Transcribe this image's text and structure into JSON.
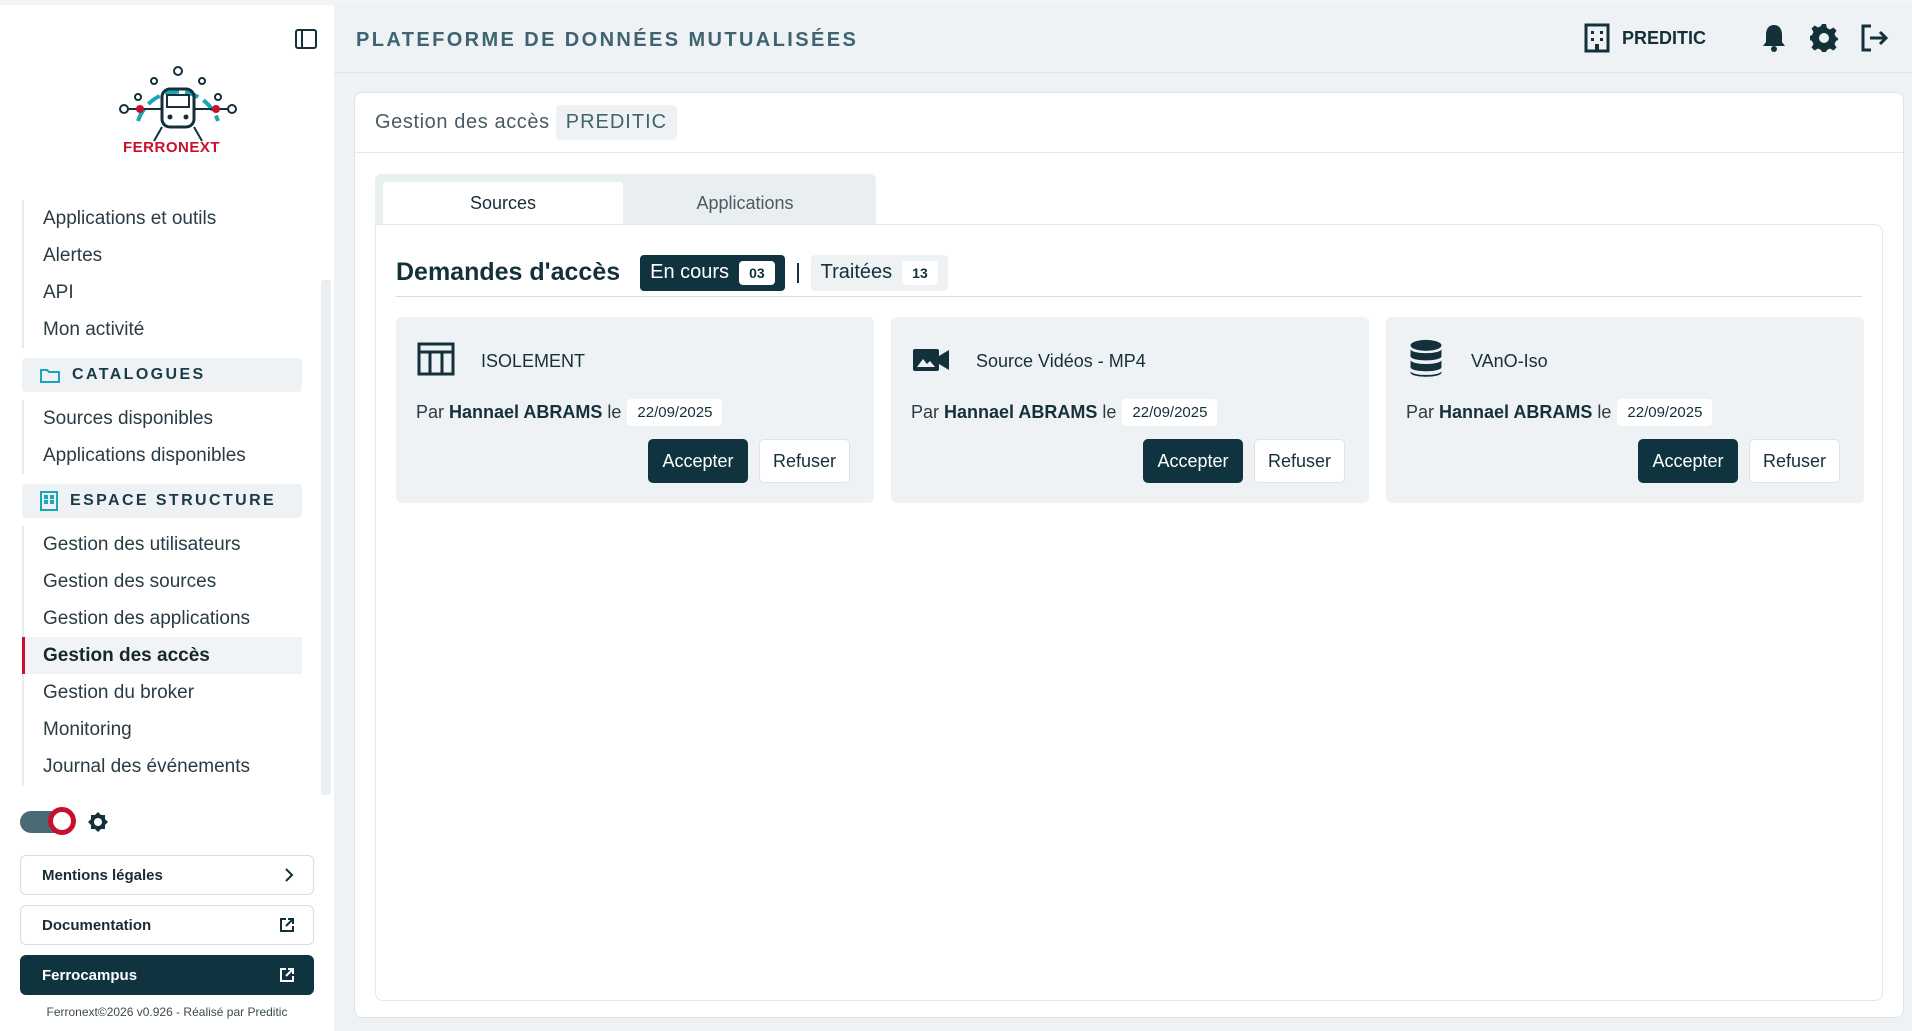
{
  "header": {
    "title": "PLATEFORME DE DONNÉES MUTUALISÉES",
    "org_name": "PREDITIC"
  },
  "sidebar": {
    "logo_text": "FERRONEXT",
    "items_top": [
      "Applications et outils",
      "Alertes",
      "API",
      "Mon activité"
    ],
    "section_catalogues": "CATALOGUES",
    "items_catalogues": [
      "Sources disponibles",
      "Applications disponibles"
    ],
    "section_structure": "ESPACE STRUCTURE",
    "items_structure": [
      "Gestion des utilisateurs",
      "Gestion des sources",
      "Gestion des applications",
      "Gestion des accès",
      "Gestion du broker",
      "Monitoring",
      "Journal des événements"
    ],
    "active_item": "Gestion des accès",
    "buttons": {
      "mentions": "Mentions légales",
      "documentation": "Documentation",
      "ferrocampus": "Ferrocampus"
    },
    "footer": "Ferronext©2026 v0.926 - Réalisé par Preditic"
  },
  "page": {
    "title": "Gestion des accès",
    "org_badge": "PREDITIC",
    "tabs": [
      "Sources",
      "Applications"
    ],
    "active_tab": "Sources",
    "requests_title": "Demandes d'accès",
    "filters": [
      {
        "label": "En cours",
        "count": "03"
      },
      {
        "label": "Traitées",
        "count": "13"
      }
    ],
    "cards": [
      {
        "icon": "table-icon",
        "name": "ISOLEMENT",
        "by_prefix": "Par",
        "author": "Hannael ABRAMS",
        "le": "le",
        "date": "22/09/2025",
        "accept": "Accepter",
        "refuse": "Refuser"
      },
      {
        "icon": "video-icon",
        "name": "Source Vidéos - MP4",
        "by_prefix": "Par",
        "author": "Hannael ABRAMS",
        "le": "le",
        "date": "22/09/2025",
        "accept": "Accepter",
        "refuse": "Refuser"
      },
      {
        "icon": "database-icon",
        "name": "VAnO-Iso",
        "by_prefix": "Par",
        "author": "Hannael ABRAMS",
        "le": "le",
        "date": "22/09/2025",
        "accept": "Accepter",
        "refuse": "Refuser"
      }
    ]
  },
  "colors": {
    "primary": "#0f3440",
    "accent": "#c8102e",
    "teal": "#1aa5b8"
  }
}
